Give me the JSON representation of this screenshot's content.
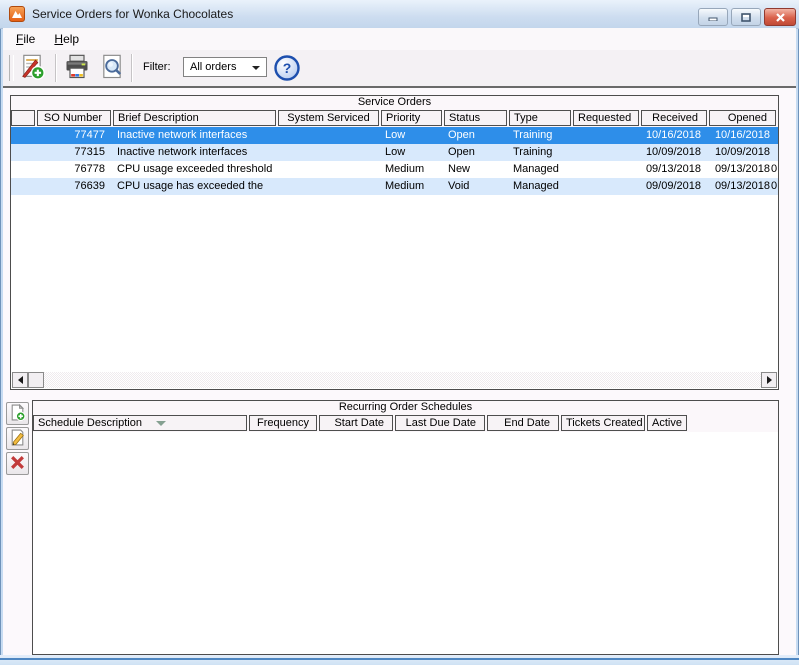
{
  "colors": {
    "selected_row": "#2e8ee9",
    "alt_row": "#d8e9fc",
    "titlebar": "#cdddf0",
    "close_button": "#c04a36"
  },
  "window": {
    "title": "Service Orders for Wonka Chocolates"
  },
  "menu": {
    "file": {
      "accel": "F",
      "rest": "ile"
    },
    "help": {
      "accel": "H",
      "rest": "elp"
    }
  },
  "toolbar": {
    "filter_label": "Filter:",
    "filter_value": "All orders",
    "icons": [
      "new-service-order",
      "print",
      "print-preview",
      "help"
    ]
  },
  "service_orders": {
    "title": "Service Orders",
    "columns": {
      "selector": "",
      "so_number": "SO Number",
      "brief_description": "Brief Description",
      "system_serviced": "System Serviced",
      "priority": "Priority",
      "status": "Status",
      "type": "Type",
      "requested": "Requested",
      "received": "Received",
      "opened": "Opened"
    },
    "selected_index": 0,
    "rows": [
      {
        "so_number": "77477",
        "brief_description": "Inactive network interfaces",
        "system_serviced": "",
        "priority": "Low",
        "status": "Open",
        "type": "Training",
        "requested": "",
        "received": "10/16/2018",
        "opened": "10/16/2018",
        "overflow": ""
      },
      {
        "so_number": "77315",
        "brief_description": "Inactive network interfaces",
        "system_serviced": "",
        "priority": "Low",
        "status": "Open",
        "type": "Training",
        "requested": "",
        "received": "10/09/2018",
        "opened": "10/09/2018",
        "overflow": ""
      },
      {
        "so_number": "76778",
        "brief_description": "CPU usage exceeded threshold",
        "system_serviced": "",
        "priority": "Medium",
        "status": "New",
        "type": "Managed",
        "requested": "",
        "received": "09/13/2018",
        "opened": "09/13/2018",
        "overflow": "0"
      },
      {
        "so_number": "76639",
        "brief_description": "CPU usage has exceeded the",
        "system_serviced": "",
        "priority": "Medium",
        "status": "Void",
        "type": "Managed",
        "requested": "",
        "received": "09/09/2018",
        "opened": "09/13/2018",
        "overflow": "0"
      }
    ]
  },
  "recurring": {
    "title": "Recurring Order Schedules",
    "columns": [
      "Schedule Description",
      "Frequency",
      "Start Date",
      "Last Due Date",
      "End Date",
      "Tickets Created",
      "Active"
    ],
    "rows": []
  }
}
